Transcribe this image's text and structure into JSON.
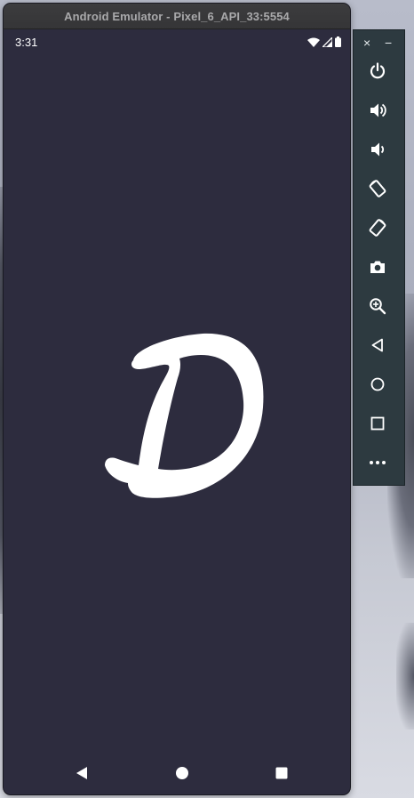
{
  "window": {
    "title": "Android Emulator - Pixel_6_API_33:5554"
  },
  "status_bar": {
    "time": "3:31",
    "icons": [
      "wifi-icon",
      "cellular-signal-icon",
      "battery-icon"
    ]
  },
  "app": {
    "logo_letter": "D",
    "background_color": "#2d2c3e",
    "logo_color": "#ffffff"
  },
  "nav_bar": {
    "buttons": [
      "back",
      "home",
      "recents"
    ]
  },
  "toolbar": {
    "window_controls": {
      "close_label": "×",
      "minimize_label": "−"
    },
    "buttons": [
      "power",
      "volume-up",
      "volume-down",
      "rotate-left",
      "rotate-right",
      "screenshot",
      "zoom",
      "back",
      "home",
      "overview",
      "more"
    ]
  }
}
